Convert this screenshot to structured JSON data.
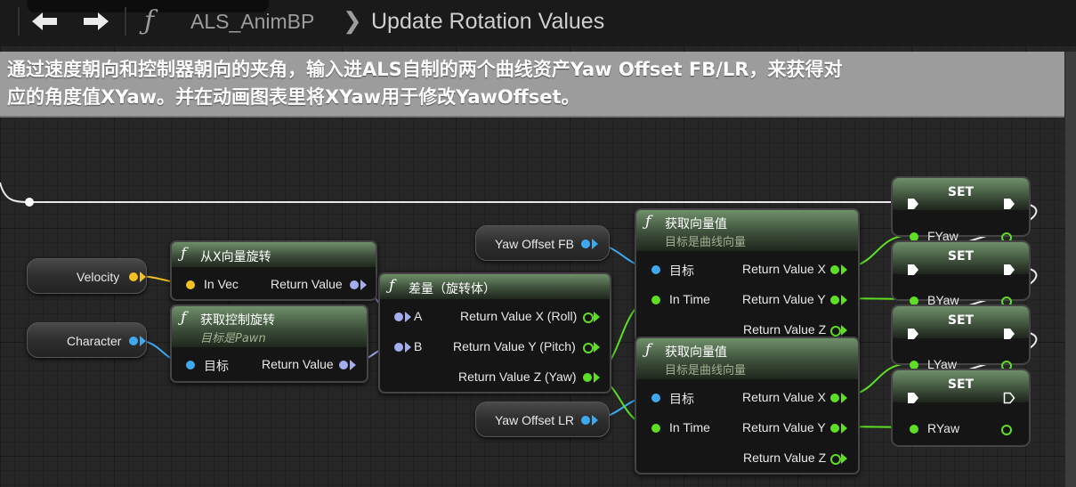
{
  "topbar": {
    "back_label": "🡐",
    "forward_label": "🡒",
    "function_glyph": "ƒ",
    "breadcrumb_blueprint": "ALS_AnimBP",
    "breadcrumb_separator": "❯",
    "breadcrumb_graph": "Update Rotation Values"
  },
  "comment": {
    "text_line1": "通过速度朝向和控制器朝向的夹角，输入进ALS自制的两个曲线资产Yaw Offset FB/LR，来获得对",
    "text_line2": "应的角度值XYaw。并在动画图表里将XYaw用于修改YawOffset。"
  },
  "nodes": {
    "velocity": {
      "label": "Velocity"
    },
    "character": {
      "label": "Character"
    },
    "from_x_vector": {
      "glyph": "ƒ",
      "title": "从X向量旋转",
      "in": "In Vec",
      "out": "Return Value"
    },
    "get_control_rotation": {
      "glyph": "ƒ",
      "title": "获取控制旋转",
      "subtitle": "目标是Pawn",
      "in": "目标",
      "out": "Return Value"
    },
    "delta_rotator": {
      "glyph": "ƒ",
      "title": "差量（旋转体）",
      "in_a": "A",
      "in_b": "B",
      "out_x": "Return Value X (Roll)",
      "out_y": "Return Value Y (Pitch)",
      "out_z": "Return Value Z (Yaw)"
    },
    "yaw_offset_fb": {
      "label": "Yaw Offset FB"
    },
    "yaw_offset_lr": {
      "label": "Yaw Offset LR"
    },
    "get_vector_value_1": {
      "glyph": "ƒ",
      "title": "获取向量值",
      "subtitle": "目标是曲线向量",
      "in_target": "目标",
      "in_time": "In Time",
      "out_x": "Return Value X",
      "out_y": "Return Value Y",
      "out_z": "Return Value Z"
    },
    "get_vector_value_2": {
      "glyph": "ƒ",
      "title": "获取向量值",
      "subtitle": "目标是曲线向量",
      "in_target": "目标",
      "in_time": "In Time",
      "out_x": "Return Value X",
      "out_y": "Return Value Y",
      "out_z": "Return Value Z"
    },
    "set_nodes": [
      {
        "title": "SET",
        "var": "FYaw"
      },
      {
        "title": "SET",
        "var": "BYaw"
      },
      {
        "title": "SET",
        "var": "LYaw"
      },
      {
        "title": "SET",
        "var": "RYaw"
      }
    ]
  },
  "colors": {
    "vector_pin": "#f5c021",
    "object_pin": "#3fa9f0",
    "float_pin": "#5ede25",
    "rotator_pin": "#a4adf0",
    "exec_pin": "#ffffff",
    "comment_bg": "#9c9c9c"
  }
}
